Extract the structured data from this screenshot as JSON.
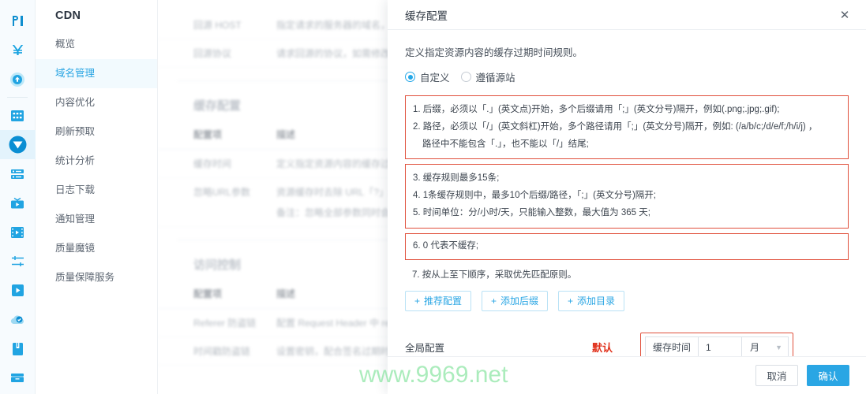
{
  "rail": {
    "icons": [
      {
        "name": "logo-icon",
        "glyph": "℘"
      },
      {
        "name": "yuan-currency-icon",
        "glyph": "¥"
      },
      {
        "name": "upload-cloud-icon",
        "glyph": "⬆"
      },
      {
        "name": "grid-apps-icon",
        "glyph": "▦"
      },
      {
        "name": "cdn-shield-icon",
        "glyph": "▼"
      },
      {
        "name": "server-stack-icon",
        "glyph": "≡"
      },
      {
        "name": "live-video-icon",
        "glyph": "▶"
      },
      {
        "name": "video-on-demand-icon",
        "glyph": "▶"
      },
      {
        "name": "settings-sliders-icon",
        "glyph": "☲"
      },
      {
        "name": "media-player-icon",
        "glyph": "▶"
      },
      {
        "name": "cloud-storage-icon",
        "glyph": "☁"
      },
      {
        "name": "document-icon",
        "glyph": "▤"
      },
      {
        "name": "archive-box-icon",
        "glyph": "▬"
      }
    ],
    "active_index": 4
  },
  "sidebar": {
    "title": "CDN",
    "items": [
      {
        "label": "概览",
        "active": false
      },
      {
        "label": "域名管理",
        "active": true
      },
      {
        "label": "内容优化",
        "active": false
      },
      {
        "label": "刷新预取",
        "active": false
      },
      {
        "label": "统计分析",
        "active": false
      },
      {
        "label": "日志下载",
        "active": false
      },
      {
        "label": "通知管理",
        "active": false
      },
      {
        "label": "质量魔镜",
        "active": false
      },
      {
        "label": "质量保障服务",
        "active": false
      }
    ]
  },
  "background": {
    "top_rows": [
      {
        "item": "回源 HOST",
        "desc": "指定请求的服务器的域名，默认为"
      },
      {
        "item": "回源协议",
        "desc": "请求回源的协议，如需修改回源协"
      }
    ],
    "section1_title": "缓存配置",
    "col_item": "配置项",
    "col_desc": "描述",
    "section1_rows": [
      {
        "item": "缓存时间",
        "desc": "定义指定资源内容的缓存过期时",
        "sub": ""
      },
      {
        "item": "忽略URL参数",
        "desc": "资源缓存时去除 URL「?」后的全",
        "sub": "备注：忽略全部参数同时会导致"
      }
    ],
    "section2_title": "访问控制",
    "section2_rows": [
      {
        "item": "Referer 防盗链",
        "desc": "配置 Request Header 中 referer 字",
        "sub": ""
      },
      {
        "item": "时间戳防盗链",
        "desc": "设置密钥，配合签名过期时间来",
        "sub": ""
      }
    ]
  },
  "modal": {
    "title": "缓存配置",
    "close_label": "✕",
    "lead": "定义指定资源内容的缓存过期时间规则。",
    "radios": [
      {
        "label": "自定义",
        "selected": true
      },
      {
        "label": "遵循源站",
        "selected": false
      }
    ],
    "rules_box1": [
      "1. 后缀，必须以「.」(英文点)开始，多个后缀请用「;」(英文分号)隔开，例如(.png;.jpg;.gif);",
      "2. 路径，必须以「/」(英文斜杠)开始，多个路径请用「;」(英文分号)隔开，例如: (/a/b/c;/d/e/f;/h/i/j) ，",
      "路径中不能包含「.」，也不能以「/」结尾;"
    ],
    "rules_box2": [
      "3. 缓存规则最多15条;",
      "4. 1条缓存规则中，最多10个后缀/路径，「;」(英文分号)隔开;",
      "5. 时间单位：分/小时/天，只能输入整数，最大值为 365 天;"
    ],
    "rules_box3": [
      "6. 0 代表不缓存;"
    ],
    "rule7": "7. 按从上至下顺序，采取优先匹配原则。",
    "action_buttons": [
      {
        "label": "推荐配置",
        "icon": "plus-icon"
      },
      {
        "label": "添加后缀",
        "icon": "plus-icon"
      },
      {
        "label": "添加目录",
        "icon": "plus-icon"
      }
    ],
    "global": {
      "label": "全局配置",
      "default_tag": "默认",
      "time_label": "缓存时间",
      "time_value": "1",
      "time_unit": "月"
    },
    "footer": {
      "cancel": "取消",
      "confirm": "确认"
    }
  },
  "watermark": "www.9969.net",
  "colors": {
    "accent": "#2aa6e4",
    "highlight_border": "#e0503c",
    "default_tag": "#e0301a",
    "watermark": "#8fe6a6"
  }
}
